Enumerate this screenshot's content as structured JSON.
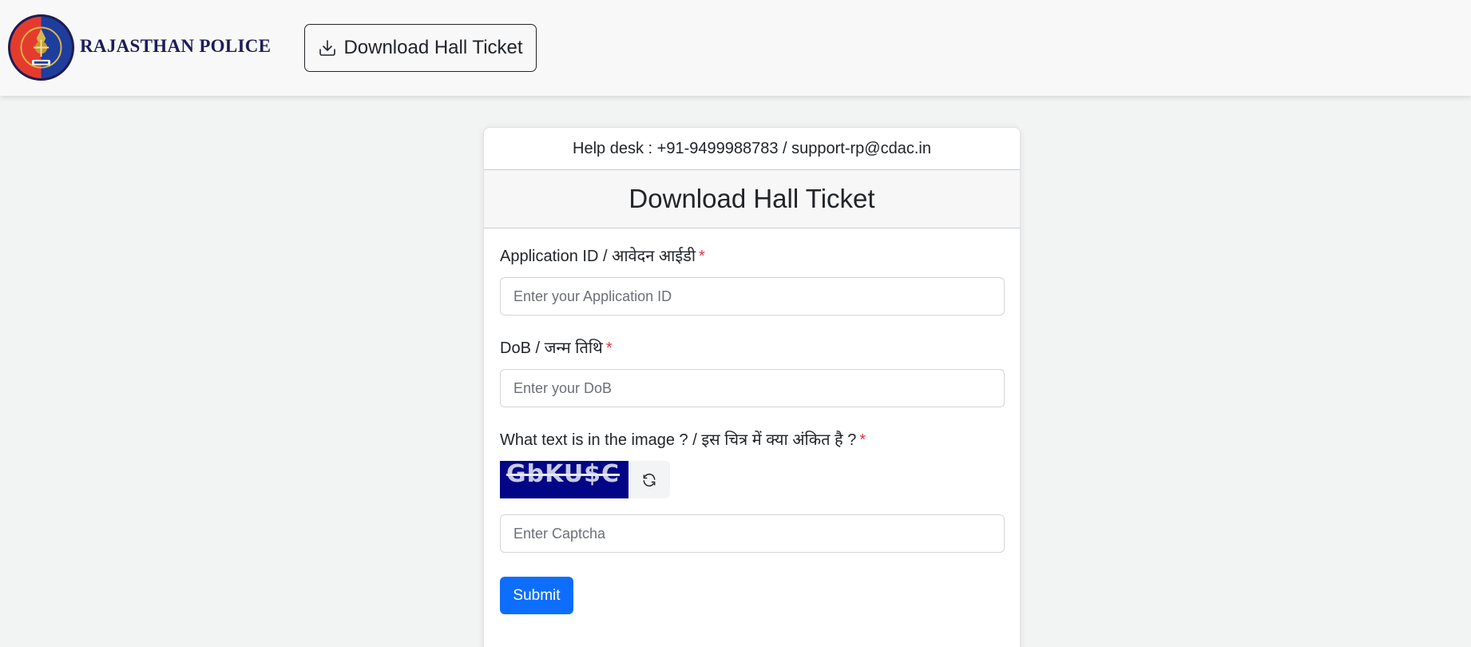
{
  "header": {
    "brand": "RAJASTHAN POLICE",
    "download_button_label": "Download Hall Ticket",
    "download_icon": "download-icon",
    "logo": "rajasthan-police-emblem"
  },
  "card": {
    "helpdesk": "Help desk : +91-9499988783 / support-rp@cdac.in",
    "title": "Download Hall Ticket",
    "fields": {
      "application_id": {
        "label": "Application ID / आवेदन आईडी",
        "required_mark": "*",
        "value": "",
        "placeholder": "Enter your Application ID"
      },
      "dob": {
        "label": "DoB / जन्म तिथि",
        "required_mark": "*",
        "value": "",
        "placeholder": "Enter your DoB"
      },
      "captcha": {
        "label": "What text is in the image ? / इस चित्र में क्या अंकित है ?",
        "required_mark": "*",
        "image_text": "GbKU$C",
        "refresh_icon": "refresh-icon",
        "value": "",
        "placeholder": "Enter Captcha"
      }
    },
    "submit_label": "Submit"
  },
  "colors": {
    "primary": "#0d6efd",
    "brand_text": "#1e1c5a",
    "required": "#dc3545",
    "captcha_bg": "#020585",
    "page_bg": "#f2f3f3"
  }
}
